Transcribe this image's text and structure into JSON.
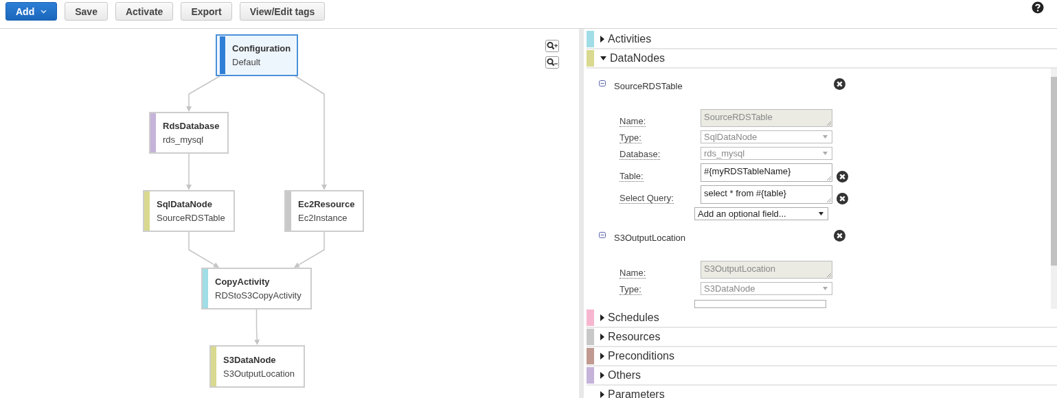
{
  "toolbar": {
    "buttons": [
      {
        "label": "Add",
        "kind": "primary"
      },
      {
        "label": "Save",
        "kind": "default"
      },
      {
        "label": "Activate",
        "kind": "default"
      },
      {
        "label": "Export",
        "kind": "default"
      },
      {
        "label": "View/Edit tags",
        "kind": "default"
      }
    ]
  },
  "diagram": {
    "nodes": [
      {
        "title": "Configuration",
        "subtitle": "Default",
        "color": "#2f7fd8",
        "selected": true
      },
      {
        "title": "RdsDatabase",
        "subtitle": "rds_mysql",
        "color": "#c5b3da",
        "selected": false
      },
      {
        "title": "SqlDataNode",
        "subtitle": "SourceRDSTable",
        "color": "#d9d98f",
        "selected": false
      },
      {
        "title": "Ec2Resource",
        "subtitle": "Ec2Instance",
        "color": "#c8c8c8",
        "selected": false
      },
      {
        "title": "CopyActivity",
        "subtitle": "RDStoS3CopyActivity",
        "color": "#a0dde6",
        "selected": false
      },
      {
        "title": "S3DataNode",
        "subtitle": "S3OutputLocation",
        "color": "#d9d98f",
        "selected": false
      }
    ],
    "kind": "pipeline"
  },
  "sections": [
    {
      "name": "Activities",
      "color": "#a0dde6",
      "expanded": false
    },
    {
      "name": "DataNodes",
      "color": "#d9d98f",
      "expanded": true,
      "objects": [
        {
          "name": "SourceRDSTable",
          "fields": [
            {
              "label": "Name:",
              "kind": "readonly",
              "value": "SourceRDSTable"
            },
            {
              "label": "Type:",
              "kind": "select",
              "value": "SqlDataNode"
            },
            {
              "label": "Database:",
              "kind": "select",
              "value": "rds_mysql"
            },
            {
              "label": "Table:",
              "kind": "text",
              "value": "#{myRDSTableName}",
              "removable": true
            },
            {
              "label": "Select Query:",
              "kind": "text",
              "value": "select * from #{table}",
              "removable": true
            }
          ],
          "add_field": "Add an optional field..."
        },
        {
          "name": "S3OutputLocation",
          "fields": [
            {
              "label": "Name:",
              "kind": "readonly",
              "value": "S3OutputLocation"
            },
            {
              "label": "Type:",
              "kind": "select",
              "value": "S3DataNode"
            },
            {
              "kind": "partial"
            }
          ]
        }
      ]
    },
    {
      "name": "Schedules",
      "color": "#f7b6cf",
      "expanded": false
    },
    {
      "name": "Resources",
      "color": "#c8c8c8",
      "expanded": false
    },
    {
      "name": "Preconditions",
      "color": "#c09a90",
      "expanded": false
    },
    {
      "name": "Others",
      "color": "#c5b3da",
      "expanded": false
    },
    {
      "name": "Parameters",
      "expanded": false
    }
  ]
}
